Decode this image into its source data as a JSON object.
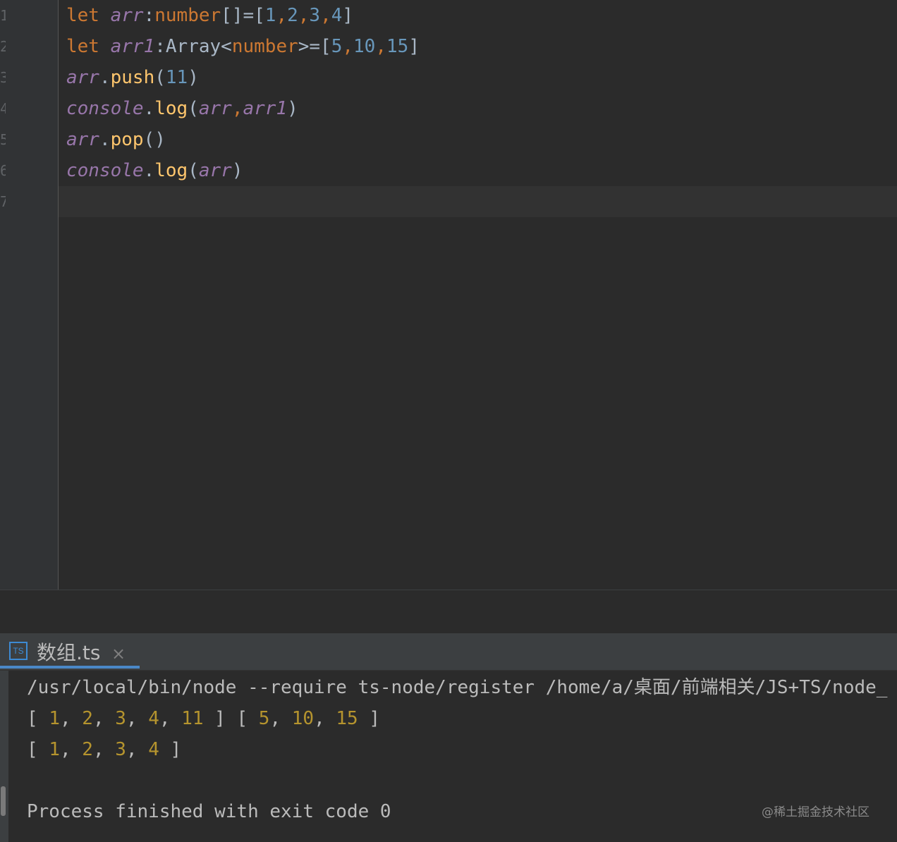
{
  "editor": {
    "gutter": {
      "line_numbers": [
        "1",
        "2",
        "3",
        "4",
        "5",
        "6",
        "7"
      ]
    },
    "code_lines": [
      [
        {
          "t": "let ",
          "c": "kw"
        },
        {
          "t": "arr",
          "c": "var"
        },
        {
          "t": ":",
          "c": "plain"
        },
        {
          "t": "number",
          "c": "type"
        },
        {
          "t": "[]=[",
          "c": "plain"
        },
        {
          "t": "1",
          "c": "num"
        },
        {
          "t": ",",
          "c": "kw"
        },
        {
          "t": "2",
          "c": "num"
        },
        {
          "t": ",",
          "c": "kw"
        },
        {
          "t": "3",
          "c": "num"
        },
        {
          "t": ",",
          "c": "kw"
        },
        {
          "t": "4",
          "c": "num"
        },
        {
          "t": "]",
          "c": "plain"
        }
      ],
      [
        {
          "t": "let ",
          "c": "kw"
        },
        {
          "t": "arr1",
          "c": "var"
        },
        {
          "t": ":Array<",
          "c": "plain"
        },
        {
          "t": "number",
          "c": "type"
        },
        {
          "t": ">=[",
          "c": "plain"
        },
        {
          "t": "5",
          "c": "num"
        },
        {
          "t": ",",
          "c": "kw"
        },
        {
          "t": "10",
          "c": "num"
        },
        {
          "t": ",",
          "c": "kw"
        },
        {
          "t": "15",
          "c": "num"
        },
        {
          "t": "]",
          "c": "plain"
        }
      ],
      [
        {
          "t": "arr",
          "c": "var"
        },
        {
          "t": ".",
          "c": "plain"
        },
        {
          "t": "push",
          "c": "fn"
        },
        {
          "t": "(",
          "c": "plain"
        },
        {
          "t": "11",
          "c": "num"
        },
        {
          "t": ")",
          "c": "plain"
        }
      ],
      [
        {
          "t": "console",
          "c": "var"
        },
        {
          "t": ".",
          "c": "plain"
        },
        {
          "t": "log",
          "c": "fn"
        },
        {
          "t": "(",
          "c": "plain"
        },
        {
          "t": "arr",
          "c": "var"
        },
        {
          "t": ",",
          "c": "kw"
        },
        {
          "t": "arr1",
          "c": "var"
        },
        {
          "t": ")",
          "c": "plain"
        }
      ],
      [
        {
          "t": "arr",
          "c": "var"
        },
        {
          "t": ".",
          "c": "plain"
        },
        {
          "t": "pop",
          "c": "fn"
        },
        {
          "t": "()",
          "c": "plain"
        }
      ],
      [
        {
          "t": "console",
          "c": "var"
        },
        {
          "t": ".",
          "c": "plain"
        },
        {
          "t": "log",
          "c": "fn"
        },
        {
          "t": "(",
          "c": "plain"
        },
        {
          "t": "arr",
          "c": "var"
        },
        {
          "t": ")",
          "c": "plain"
        }
      ],
      []
    ]
  },
  "run_panel": {
    "tab": {
      "icon": "typescript-file-icon",
      "icon_text": "TS",
      "label": "数组.ts",
      "close_glyph": "×"
    },
    "console_lines": [
      [
        {
          "t": "/usr/local/bin/node --require ts-node/register /home/a/桌面/前端相关/JS+TS/node_",
          "c": "text"
        }
      ],
      [
        {
          "t": "[ ",
          "c": "text"
        },
        {
          "t": "1",
          "c": "cnum"
        },
        {
          "t": ", ",
          "c": "text"
        },
        {
          "t": "2",
          "c": "cnum"
        },
        {
          "t": ", ",
          "c": "text"
        },
        {
          "t": "3",
          "c": "cnum"
        },
        {
          "t": ", ",
          "c": "text"
        },
        {
          "t": "4",
          "c": "cnum"
        },
        {
          "t": ", ",
          "c": "text"
        },
        {
          "t": "11",
          "c": "cnum"
        },
        {
          "t": " ] [ ",
          "c": "text"
        },
        {
          "t": "5",
          "c": "cnum"
        },
        {
          "t": ", ",
          "c": "text"
        },
        {
          "t": "10",
          "c": "cnum"
        },
        {
          "t": ", ",
          "c": "text"
        },
        {
          "t": "15",
          "c": "cnum"
        },
        {
          "t": " ]",
          "c": "text"
        }
      ],
      [
        {
          "t": "[ ",
          "c": "text"
        },
        {
          "t": "1",
          "c": "cnum"
        },
        {
          "t": ", ",
          "c": "text"
        },
        {
          "t": "2",
          "c": "cnum"
        },
        {
          "t": ", ",
          "c": "text"
        },
        {
          "t": "3",
          "c": "cnum"
        },
        {
          "t": ", ",
          "c": "text"
        },
        {
          "t": "4",
          "c": "cnum"
        },
        {
          "t": " ]",
          "c": "text"
        }
      ],
      [],
      [
        {
          "t": "Process finished with exit code 0",
          "c": "text"
        }
      ]
    ]
  },
  "watermark": "@稀土掘金技术社区",
  "colors": {
    "background": "#2b2b2b",
    "gutter": "#313335",
    "keyword": "#cc7832",
    "variable": "#9876aa",
    "number": "#6897bb",
    "function": "#ffc66d",
    "console_number": "#b5942e",
    "tab_accent": "#4a88c7"
  }
}
